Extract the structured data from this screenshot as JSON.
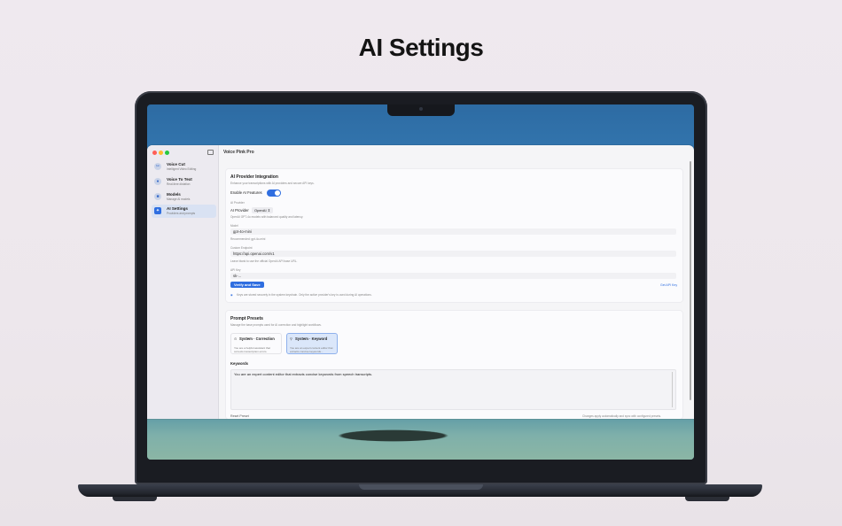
{
  "headline": "AI Settings",
  "window": {
    "title": "Voice Pink Pro"
  },
  "colors": {
    "accent": "#2f6ee0",
    "traffic_red": "#ff5f57",
    "traffic_yellow": "#febc2e",
    "traffic_green": "#28c840"
  },
  "sidebar": {
    "items": [
      {
        "title": "Voice Cut",
        "subtitle": "Intelligent Video Editing",
        "icon": "scissors-icon"
      },
      {
        "title": "Voice To Text",
        "subtitle": "Real-time dictation",
        "icon": "mic-icon"
      },
      {
        "title": "Models",
        "subtitle": "Manage AI models",
        "icon": "cube-icon"
      },
      {
        "title": "AI Settings",
        "subtitle": "Providers and prompts",
        "icon": "sparkle-icon",
        "active": true
      }
    ]
  },
  "provider": {
    "title": "AI Provider Integration",
    "subtitle": "Enhance your transcriptions with AI providers and secure API keys.",
    "enable_label": "Enable AI Features",
    "enabled": true,
    "section_label": "AI Provider",
    "provider_label": "AI Provider",
    "provider_value": "OpenAI",
    "provider_note": "OpenAI GPT-4o models with balanced quality and latency.",
    "model_label": "Model",
    "model_value": "gpt-4o-mini",
    "model_hint": "Recommended: gpt-4o-mini",
    "endpoint_label": "Custom Endpoint",
    "endpoint_value": "https://api.openai.com/v1",
    "endpoint_hint": "Leave blank to use the official OpenAI API base URL.",
    "apikey_label": "API Key",
    "apikey_value": "sk-...",
    "verify_button": "Verify and Save",
    "get_key_link": "Get API Key",
    "security_note": "Keys are stored securely in the system keychain. Only the active provider's key is used during AI operations."
  },
  "presets": {
    "title": "Prompt Presets",
    "subtitle": "Manage the base prompts used for AI correction and highlight workflows.",
    "items": [
      {
        "title": "System · Correction",
        "desc": "You are a helpful assistant that corrects transcription errors.",
        "selected": false
      },
      {
        "title": "System · Keyword",
        "desc": "You are an expert content editor that extracts concise keywords...",
        "selected": true
      }
    ],
    "editor_label": "Keywords",
    "editor_text": "You are an expert content editor that extracts concise keywords from speech transcripts.",
    "reset_label": "Reset Preset",
    "footer_note": "Changes apply automatically and sync with configured presets."
  }
}
